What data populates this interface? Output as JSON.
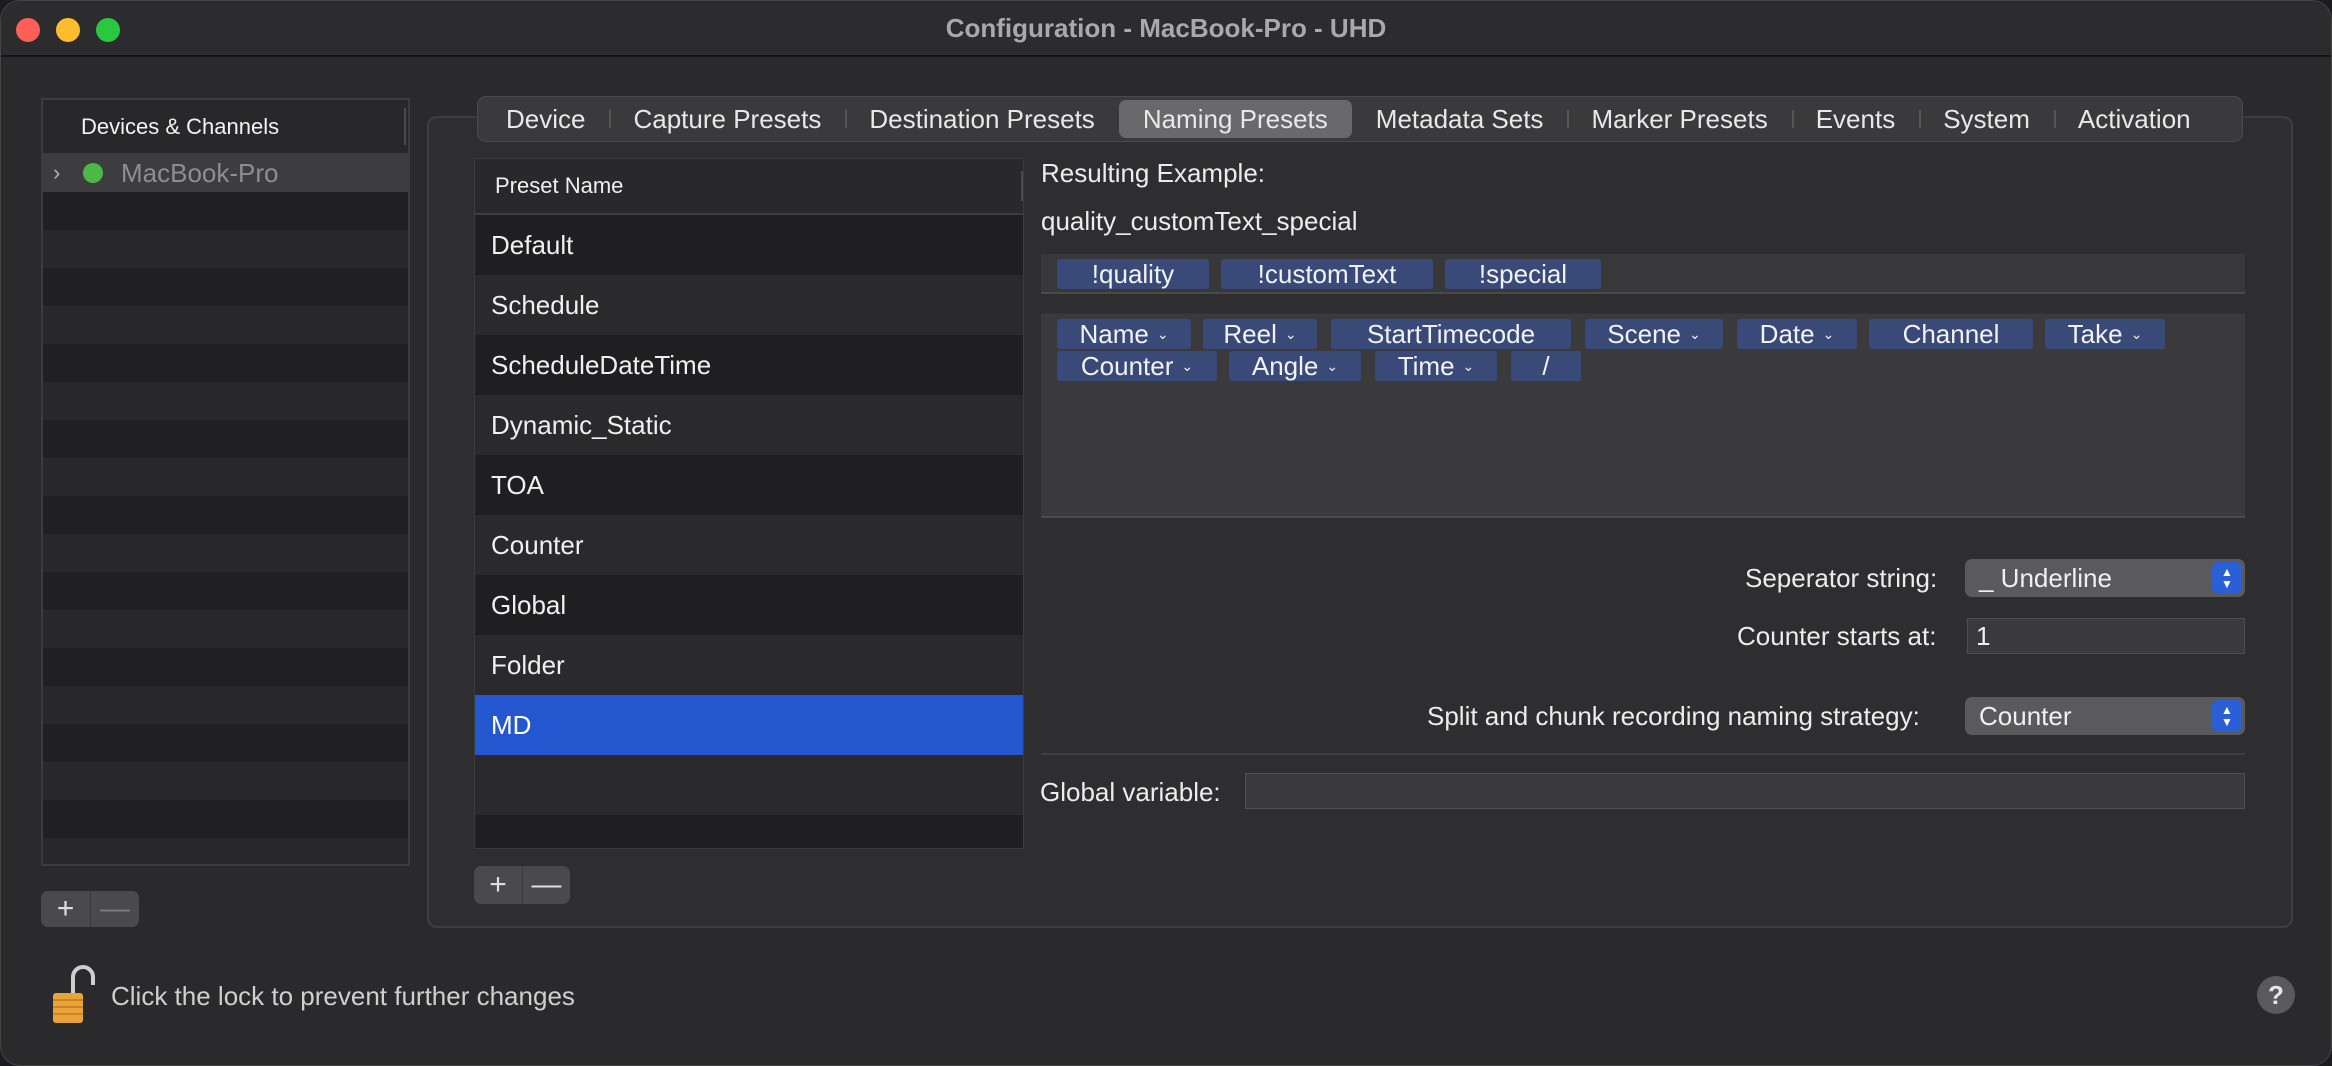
{
  "window": {
    "title": "Configuration - MacBook-Pro - UHD"
  },
  "sidebar": {
    "header": "Devices & Channels",
    "device": {
      "name": "MacBook-Pro",
      "status_color": "#4cb84a"
    },
    "add_label": "+",
    "remove_label": "—"
  },
  "tabs": [
    {
      "label": "Device"
    },
    {
      "label": "Capture Presets"
    },
    {
      "label": "Destination Presets"
    },
    {
      "label": "Naming Presets",
      "active": true
    },
    {
      "label": "Metadata Sets"
    },
    {
      "label": "Marker Presets"
    },
    {
      "label": "Events"
    },
    {
      "label": "System"
    },
    {
      "label": "Activation"
    }
  ],
  "presets": {
    "column_header": "Preset Name",
    "items": [
      "Default",
      "Schedule",
      "ScheduleDateTime",
      "Dynamic_Static",
      "TOA",
      "Counter",
      "Global",
      "Folder",
      "MD"
    ],
    "selected": "MD",
    "add_label": "+",
    "remove_label": "—"
  },
  "detail": {
    "resulting_label": "Resulting Example:",
    "resulting_value": "quality_customText_special",
    "active_tokens": [
      "!quality",
      "!customText",
      "!special"
    ],
    "available_tokens": [
      "Name",
      "Reel",
      "StartTimecode",
      "Scene",
      "Date",
      "Channel",
      "Take",
      "Counter",
      "Angle",
      "Time",
      "/"
    ],
    "separator_label": "Seperator string:",
    "separator_value": "_ Underline",
    "counter_label": "Counter starts at:",
    "counter_value": "1",
    "split_label": "Split and chunk recording naming strategy:",
    "split_value": "Counter",
    "global_label": "Global variable:",
    "global_value": ""
  },
  "footer": {
    "lock_text": "Click the lock to prevent further changes",
    "help_label": "?"
  },
  "colors": {
    "accent": "#2456cf",
    "token": "#3a4a78"
  }
}
